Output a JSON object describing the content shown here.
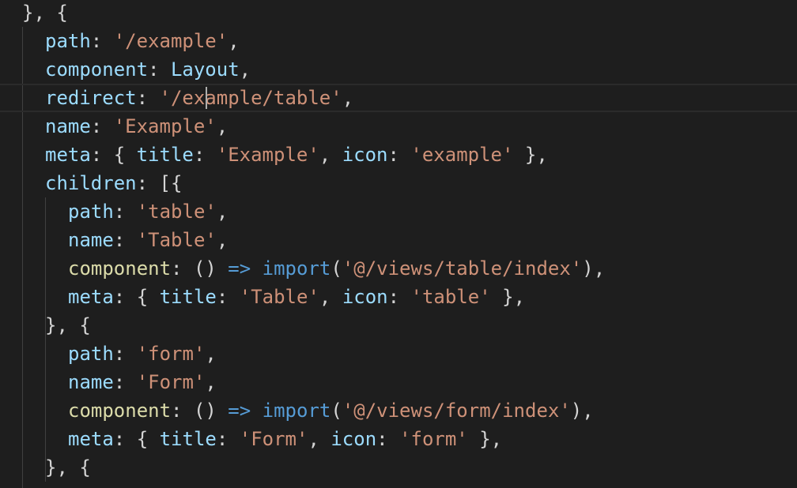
{
  "lines": [
    {
      "indent": 0,
      "tokens": [
        {
          "t": "}, {",
          "c": "punc"
        }
      ]
    },
    {
      "indent": 1,
      "tokens": [
        {
          "t": "path",
          "c": "prop"
        },
        {
          "t": ": ",
          "c": "punc"
        },
        {
          "t": "'/example'",
          "c": "str"
        },
        {
          "t": ",",
          "c": "punc"
        }
      ]
    },
    {
      "indent": 1,
      "tokens": [
        {
          "t": "component",
          "c": "prop"
        },
        {
          "t": ": ",
          "c": "punc"
        },
        {
          "t": "Layout",
          "c": "ident"
        },
        {
          "t": ",",
          "c": "punc"
        }
      ]
    },
    {
      "indent": 1,
      "current": true,
      "tokens": [
        {
          "t": "redirect",
          "c": "prop"
        },
        {
          "t": ": ",
          "c": "punc"
        },
        {
          "t": "'/example/table'",
          "c": "str"
        },
        {
          "t": ",",
          "c": "punc"
        }
      ]
    },
    {
      "indent": 1,
      "tokens": [
        {
          "t": "name",
          "c": "prop"
        },
        {
          "t": ": ",
          "c": "punc"
        },
        {
          "t": "'Example'",
          "c": "str"
        },
        {
          "t": ",",
          "c": "punc"
        }
      ]
    },
    {
      "indent": 1,
      "tokens": [
        {
          "t": "meta",
          "c": "prop"
        },
        {
          "t": ": { ",
          "c": "punc"
        },
        {
          "t": "title",
          "c": "prop"
        },
        {
          "t": ": ",
          "c": "punc"
        },
        {
          "t": "'Example'",
          "c": "str"
        },
        {
          "t": ", ",
          "c": "punc"
        },
        {
          "t": "icon",
          "c": "prop"
        },
        {
          "t": ": ",
          "c": "punc"
        },
        {
          "t": "'example'",
          "c": "str"
        },
        {
          "t": " },",
          "c": "punc"
        }
      ]
    },
    {
      "indent": 1,
      "tokens": [
        {
          "t": "children",
          "c": "prop"
        },
        {
          "t": ": [{",
          "c": "punc"
        }
      ]
    },
    {
      "indent": 2,
      "tokens": [
        {
          "t": "path",
          "c": "prop"
        },
        {
          "t": ": ",
          "c": "punc"
        },
        {
          "t": "'table'",
          "c": "str"
        },
        {
          "t": ",",
          "c": "punc"
        }
      ]
    },
    {
      "indent": 2,
      "tokens": [
        {
          "t": "name",
          "c": "prop"
        },
        {
          "t": ": ",
          "c": "punc"
        },
        {
          "t": "'Table'",
          "c": "str"
        },
        {
          "t": ",",
          "c": "punc"
        }
      ]
    },
    {
      "indent": 2,
      "tokens": [
        {
          "t": "component",
          "c": "fn"
        },
        {
          "t": ": () ",
          "c": "punc"
        },
        {
          "t": "=>",
          "c": "kw"
        },
        {
          "t": " ",
          "c": "punc"
        },
        {
          "t": "import",
          "c": "kw"
        },
        {
          "t": "(",
          "c": "punc"
        },
        {
          "t": "'@/views/table/index'",
          "c": "str"
        },
        {
          "t": "),",
          "c": "punc"
        }
      ]
    },
    {
      "indent": 2,
      "tokens": [
        {
          "t": "meta",
          "c": "prop"
        },
        {
          "t": ": { ",
          "c": "punc"
        },
        {
          "t": "title",
          "c": "prop"
        },
        {
          "t": ": ",
          "c": "punc"
        },
        {
          "t": "'Table'",
          "c": "str"
        },
        {
          "t": ", ",
          "c": "punc"
        },
        {
          "t": "icon",
          "c": "prop"
        },
        {
          "t": ": ",
          "c": "punc"
        },
        {
          "t": "'table'",
          "c": "str"
        },
        {
          "t": " },",
          "c": "punc"
        }
      ]
    },
    {
      "indent": 1,
      "tokens": [
        {
          "t": "}, {",
          "c": "punc"
        }
      ]
    },
    {
      "indent": 2,
      "tokens": [
        {
          "t": "path",
          "c": "prop"
        },
        {
          "t": ": ",
          "c": "punc"
        },
        {
          "t": "'form'",
          "c": "str"
        },
        {
          "t": ",",
          "c": "punc"
        }
      ]
    },
    {
      "indent": 2,
      "tokens": [
        {
          "t": "name",
          "c": "prop"
        },
        {
          "t": ": ",
          "c": "punc"
        },
        {
          "t": "'Form'",
          "c": "str"
        },
        {
          "t": ",",
          "c": "punc"
        }
      ]
    },
    {
      "indent": 2,
      "tokens": [
        {
          "t": "component",
          "c": "fn"
        },
        {
          "t": ": () ",
          "c": "punc"
        },
        {
          "t": "=>",
          "c": "kw"
        },
        {
          "t": " ",
          "c": "punc"
        },
        {
          "t": "import",
          "c": "kw"
        },
        {
          "t": "(",
          "c": "punc"
        },
        {
          "t": "'@/views/form/index'",
          "c": "str"
        },
        {
          "t": "),",
          "c": "punc"
        }
      ]
    },
    {
      "indent": 2,
      "tokens": [
        {
          "t": "meta",
          "c": "prop"
        },
        {
          "t": ": { ",
          "c": "punc"
        },
        {
          "t": "title",
          "c": "prop"
        },
        {
          "t": ": ",
          "c": "punc"
        },
        {
          "t": "'Form'",
          "c": "str"
        },
        {
          "t": ", ",
          "c": "punc"
        },
        {
          "t": "icon",
          "c": "prop"
        },
        {
          "t": ": ",
          "c": "punc"
        },
        {
          "t": "'form'",
          "c": "str"
        },
        {
          "t": " },",
          "c": "punc"
        }
      ]
    },
    {
      "indent": 1,
      "tokens": [
        {
          "t": "}, {",
          "c": "punc"
        }
      ]
    }
  ],
  "colors": {
    "background": "#1e1e1e",
    "property": "#9cdcfe",
    "string": "#ce9178",
    "keyword": "#569cd6",
    "function": "#dcdcaa",
    "punctuation": "#d4d4d4"
  }
}
